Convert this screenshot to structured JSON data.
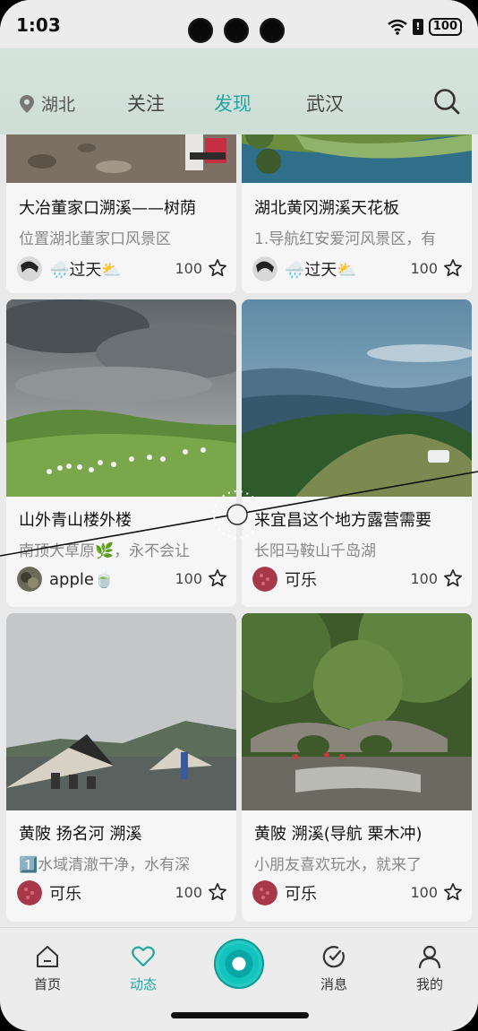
{
  "status": {
    "time": "1:03",
    "battery": "100"
  },
  "header": {
    "location": "湖北",
    "tabs": [
      {
        "label": "关注",
        "active": false
      },
      {
        "label": "发现",
        "active": true
      },
      {
        "label": "武汉",
        "active": false
      }
    ]
  },
  "cards": [
    {
      "title": "大冶董家口溯溪——树荫",
      "desc": "位置湖北董家口风景区",
      "author": "🌧️过天⛅",
      "likes": "100"
    },
    {
      "title": "湖北黄冈溯溪天花板",
      "desc": "1.导航红安爱河风景区，有",
      "author": "🌧️过天⛅",
      "likes": "100"
    },
    {
      "title": "山外青山楼外楼",
      "desc": "南顶大草原🌿，永不会让",
      "author": "apple🍵",
      "likes": "100"
    },
    {
      "title": "来宜昌这个地方露营需要",
      "desc": "长阳马鞍山千岛湖",
      "author": "可乐",
      "likes": "100"
    },
    {
      "title": "黄陂 扬名河 溯溪",
      "desc": "1️⃣水域清澈干净，水有深",
      "author": "可乐",
      "likes": "100"
    },
    {
      "title": "黄陂 溯溪(导航 栗木冲)",
      "desc": "小朋友喜欢玩水，就来了",
      "author": "可乐",
      "likes": "100"
    }
  ],
  "nav": {
    "home": "首页",
    "feed": "动态",
    "messages": "消息",
    "mine": "我的"
  },
  "colors": {
    "accent": "#21a6a2"
  }
}
